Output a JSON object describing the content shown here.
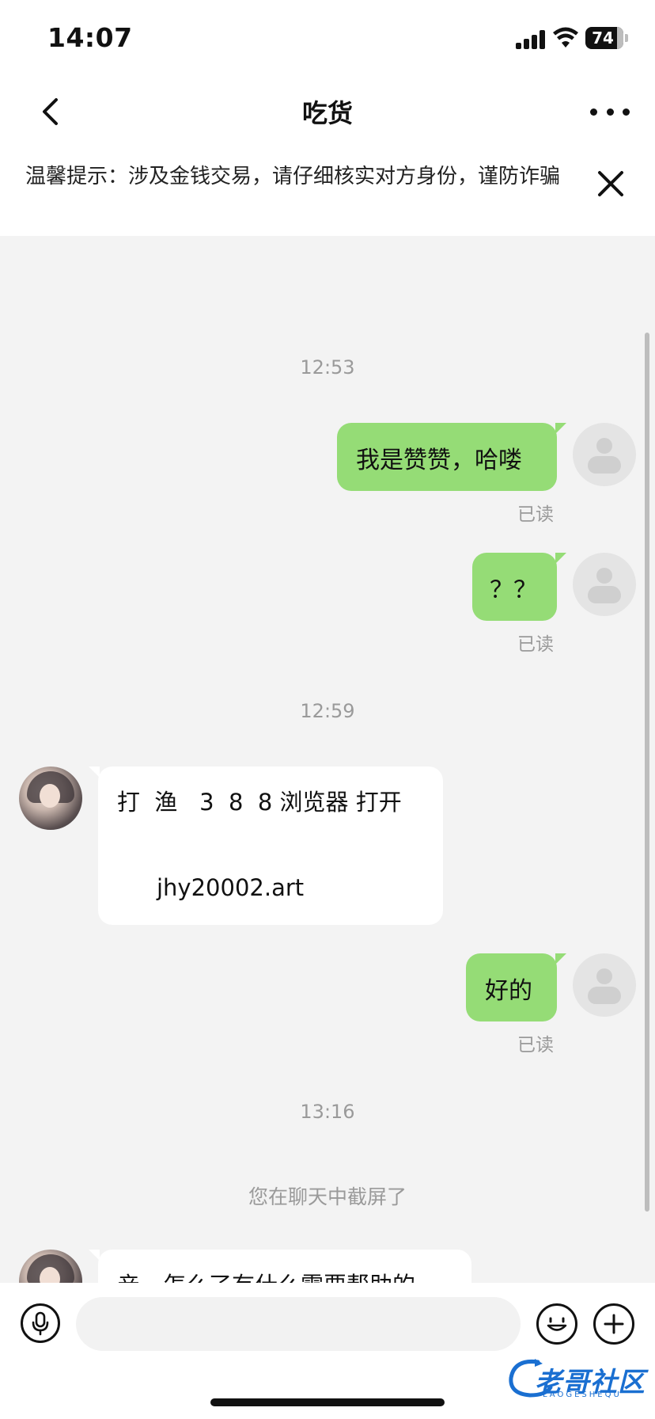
{
  "status": {
    "time": "14:07",
    "battery": "74"
  },
  "header": {
    "title": "吃货"
  },
  "notice": {
    "text": "温馨提示：涉及金钱交易，请仔细核实对方身份，谨防诈骗"
  },
  "messages": {
    "t1": "12:53",
    "m1": "我是赞赞，哈喽",
    "m1_read": "已读",
    "m2": "？？",
    "m2_read": "已读",
    "t2": "12:59",
    "m3_line1": "打  渔   3  8  8 浏览器 打开",
    "m3_line2": "jhy20002.art",
    "m4": "好的",
    "m4_read": "已读",
    "t3": "13:16",
    "system1": "您在聊天中截屏了",
    "m5": "亲，怎么了有什么需要帮助的"
  },
  "input": {
    "placeholder": ""
  },
  "watermark": {
    "text": "老哥社区",
    "sub": "LAOGESHEQU"
  }
}
